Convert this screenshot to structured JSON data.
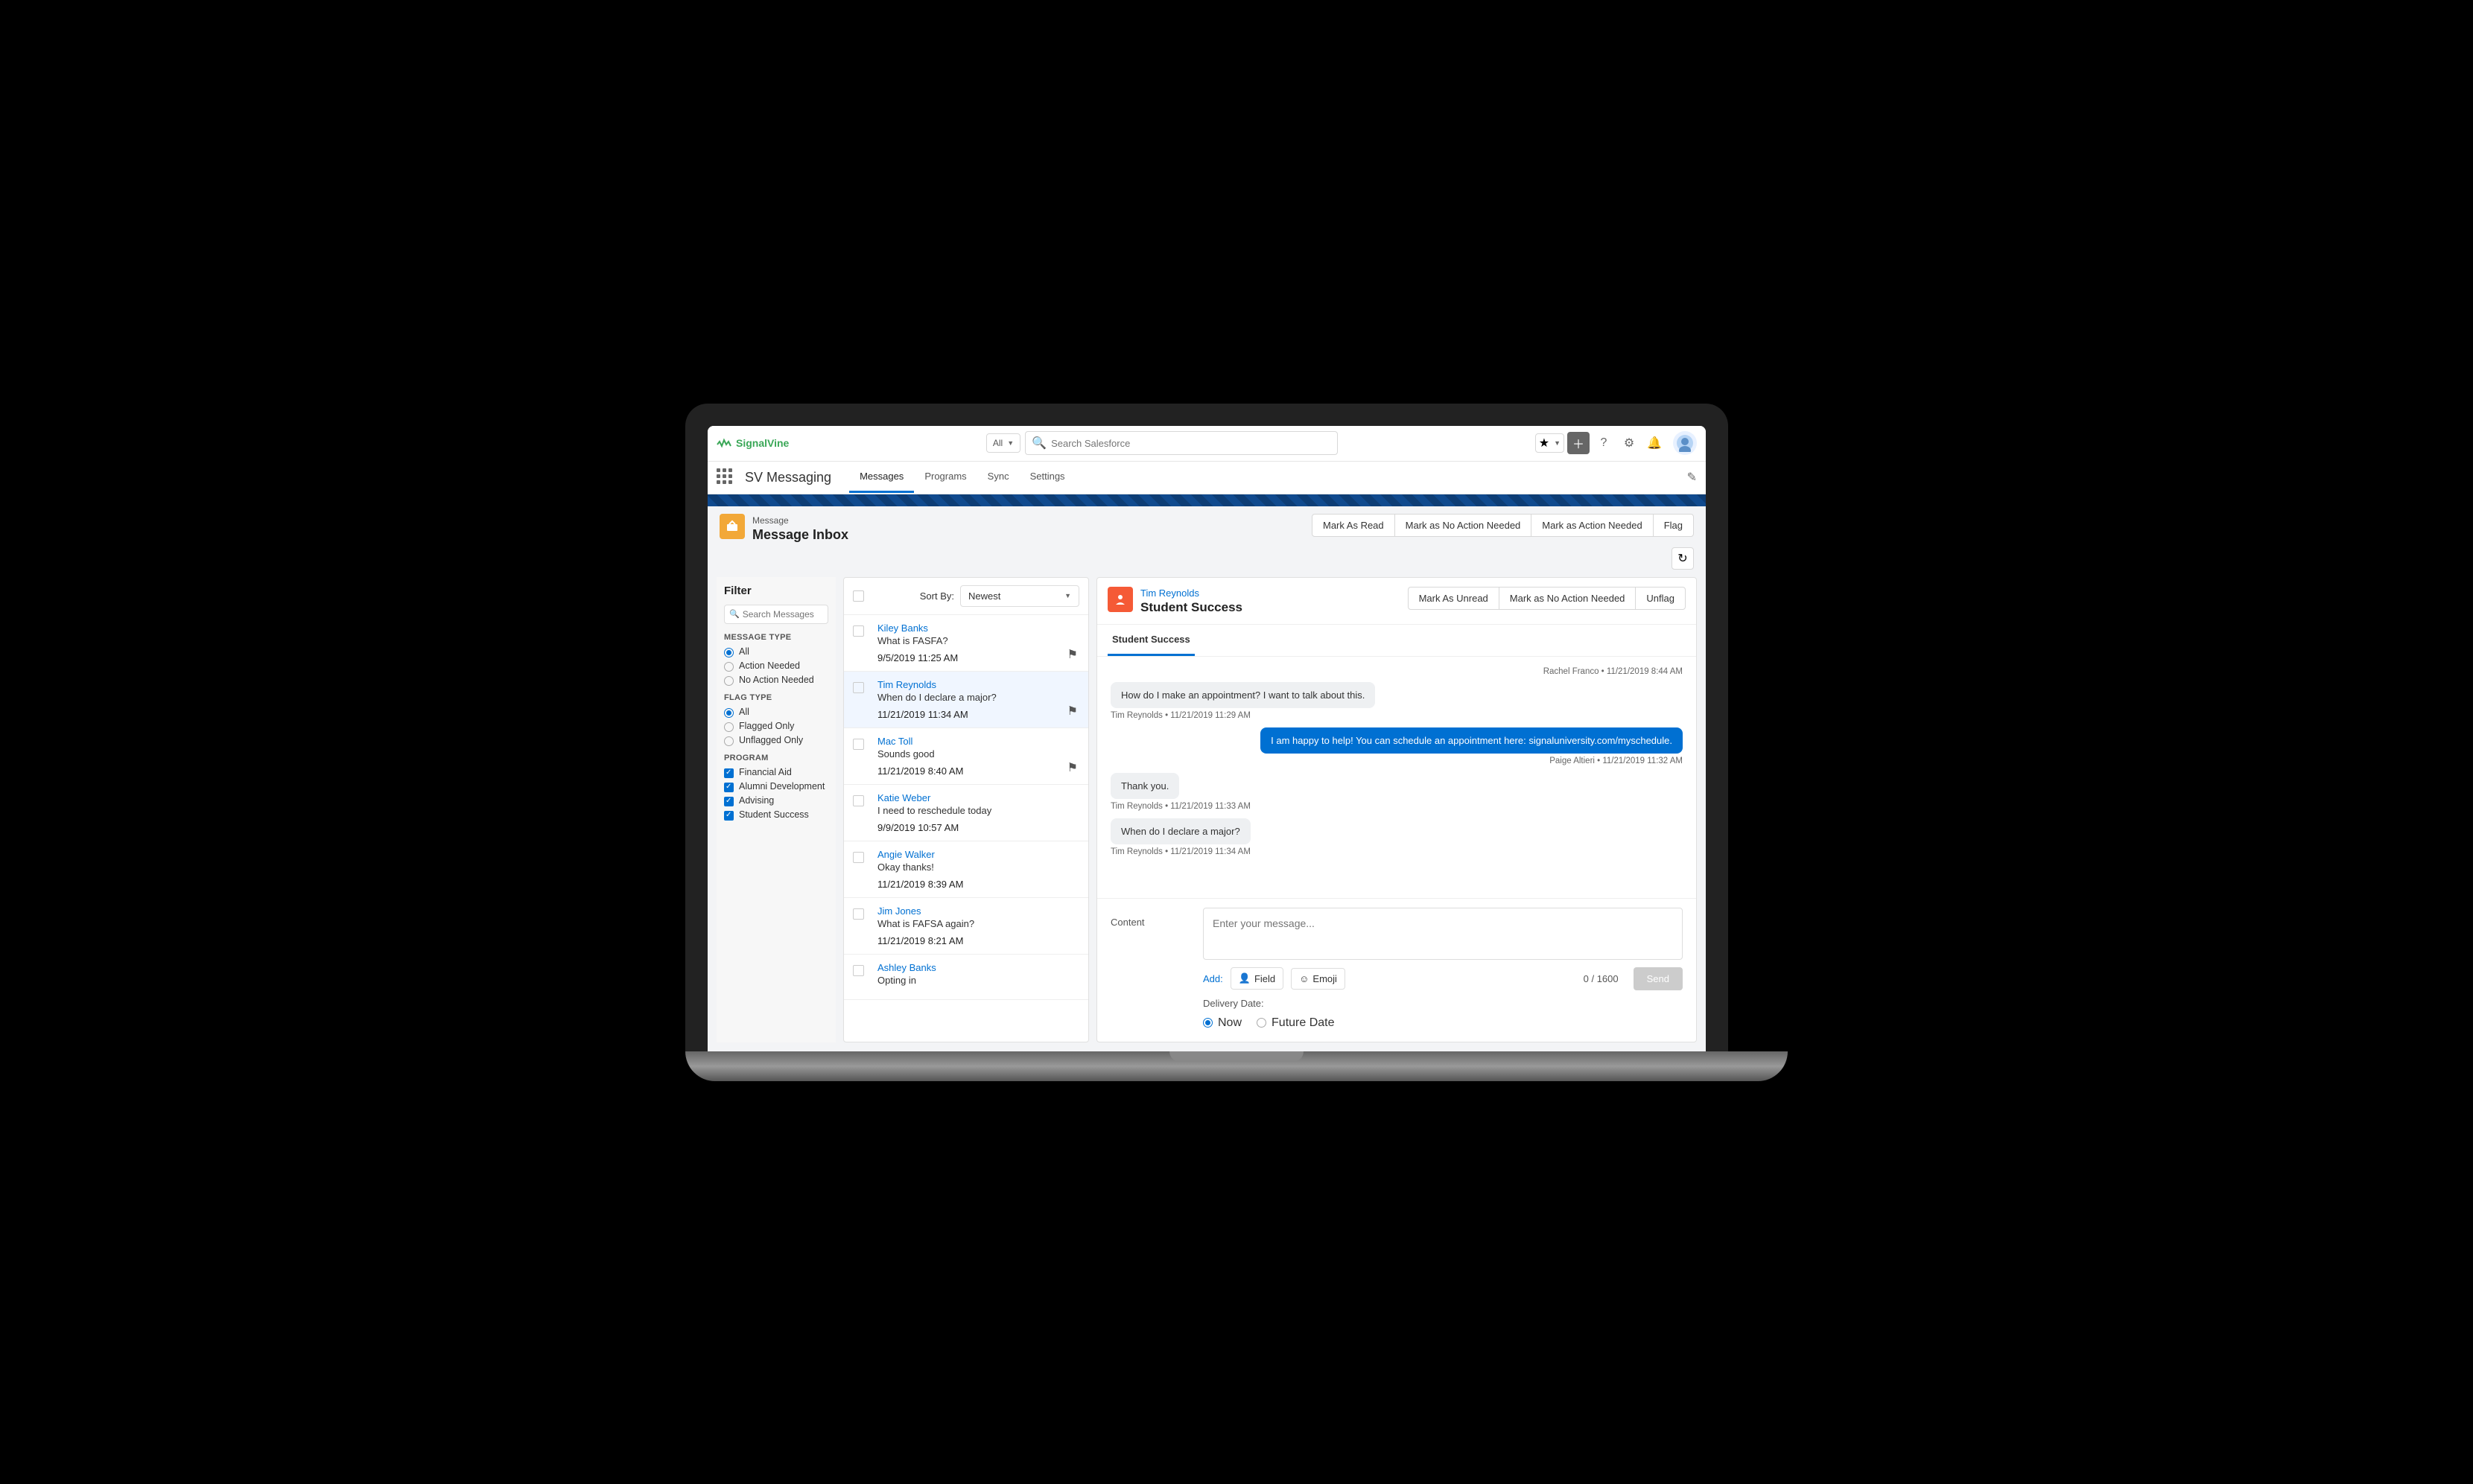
{
  "brand": "SignalVine",
  "search": {
    "scope": "All",
    "placeholder": "Search Salesforce"
  },
  "app_name": "SV Messaging",
  "nav_tabs": [
    "Messages",
    "Programs",
    "Sync",
    "Settings"
  ],
  "nav_active": 0,
  "page": {
    "type_label": "Message",
    "title": "Message Inbox"
  },
  "header_actions": [
    "Mark As Read",
    "Mark as No Action Needed",
    "Mark as Action Needed",
    "Flag"
  ],
  "filter": {
    "title": "Filter",
    "search_placeholder": "Search Messages",
    "message_type_label": "MESSAGE TYPE",
    "message_types": [
      {
        "label": "All",
        "selected": true
      },
      {
        "label": "Action Needed",
        "selected": false
      },
      {
        "label": "No Action Needed",
        "selected": false
      }
    ],
    "flag_type_label": "FLAG TYPE",
    "flag_types": [
      {
        "label": "All",
        "selected": true
      },
      {
        "label": "Flagged Only",
        "selected": false
      },
      {
        "label": "Unflagged Only",
        "selected": false
      }
    ],
    "program_label": "PROGRAM",
    "programs": [
      {
        "label": "Financial Aid",
        "checked": true
      },
      {
        "label": "Alumni Development",
        "checked": true
      },
      {
        "label": "Advising",
        "checked": true
      },
      {
        "label": "Student Success",
        "checked": true
      }
    ]
  },
  "sort": {
    "label": "Sort By:",
    "value": "Newest"
  },
  "messages": [
    {
      "from": "Kiley Banks",
      "preview": "What is FASFA?",
      "time": "9/5/2019 11:25 AM",
      "flagged": true
    },
    {
      "from": "Tim Reynolds",
      "preview": "When do I declare a major?",
      "time": "11/21/2019 11:34 AM",
      "flagged": true,
      "selected": true
    },
    {
      "from": "Mac Toll",
      "preview": "Sounds good",
      "time": "11/21/2019 8:40 AM",
      "flagged": true
    },
    {
      "from": "Katie Weber",
      "preview": "I need to reschedule today",
      "time": "9/9/2019 10:57 AM"
    },
    {
      "from": "Angie Walker",
      "preview": "Okay thanks!",
      "time": "11/21/2019 8:39 AM"
    },
    {
      "from": "Jim Jones",
      "preview": "What is FAFSA again?",
      "time": "11/21/2019 8:21 AM"
    },
    {
      "from": "Ashley Banks",
      "preview": "Opting in",
      "time": ""
    }
  ],
  "detail": {
    "contact": "Tim Reynolds",
    "title": "Student Success",
    "actions": [
      "Mark As Unread",
      "Mark as No Action Needed",
      "Unflag"
    ],
    "tab": "Student Success",
    "top_meta": "Rachel Franco • 11/21/2019 8:44 AM",
    "conversation": [
      {
        "dir": "in",
        "text": "How do I make an appointment? I want to talk about this.",
        "meta": "Tim Reynolds • 11/21/2019 11:29 AM"
      },
      {
        "dir": "out",
        "text": "I am happy to help! You can schedule an appointment here: signaluniversity.com/myschedule.",
        "meta": "Paige Altieri • 11/21/2019 11:32 AM"
      },
      {
        "dir": "in",
        "text": "Thank you.",
        "meta": "Tim Reynolds • 11/21/2019 11:33 AM"
      },
      {
        "dir": "in",
        "text": "When do I declare a major?",
        "meta": "Tim Reynolds • 11/21/2019 11:34 AM"
      }
    ]
  },
  "compose": {
    "content_label": "Content",
    "placeholder": "Enter your message...",
    "add_label": "Add:",
    "chips": [
      "Field",
      "Emoji"
    ],
    "counter": "0 / 1600",
    "send_label": "Send",
    "delivery_label": "Delivery Date:",
    "delivery_options": [
      {
        "label": "Now",
        "selected": true
      },
      {
        "label": "Future Date",
        "selected": false
      }
    ]
  }
}
